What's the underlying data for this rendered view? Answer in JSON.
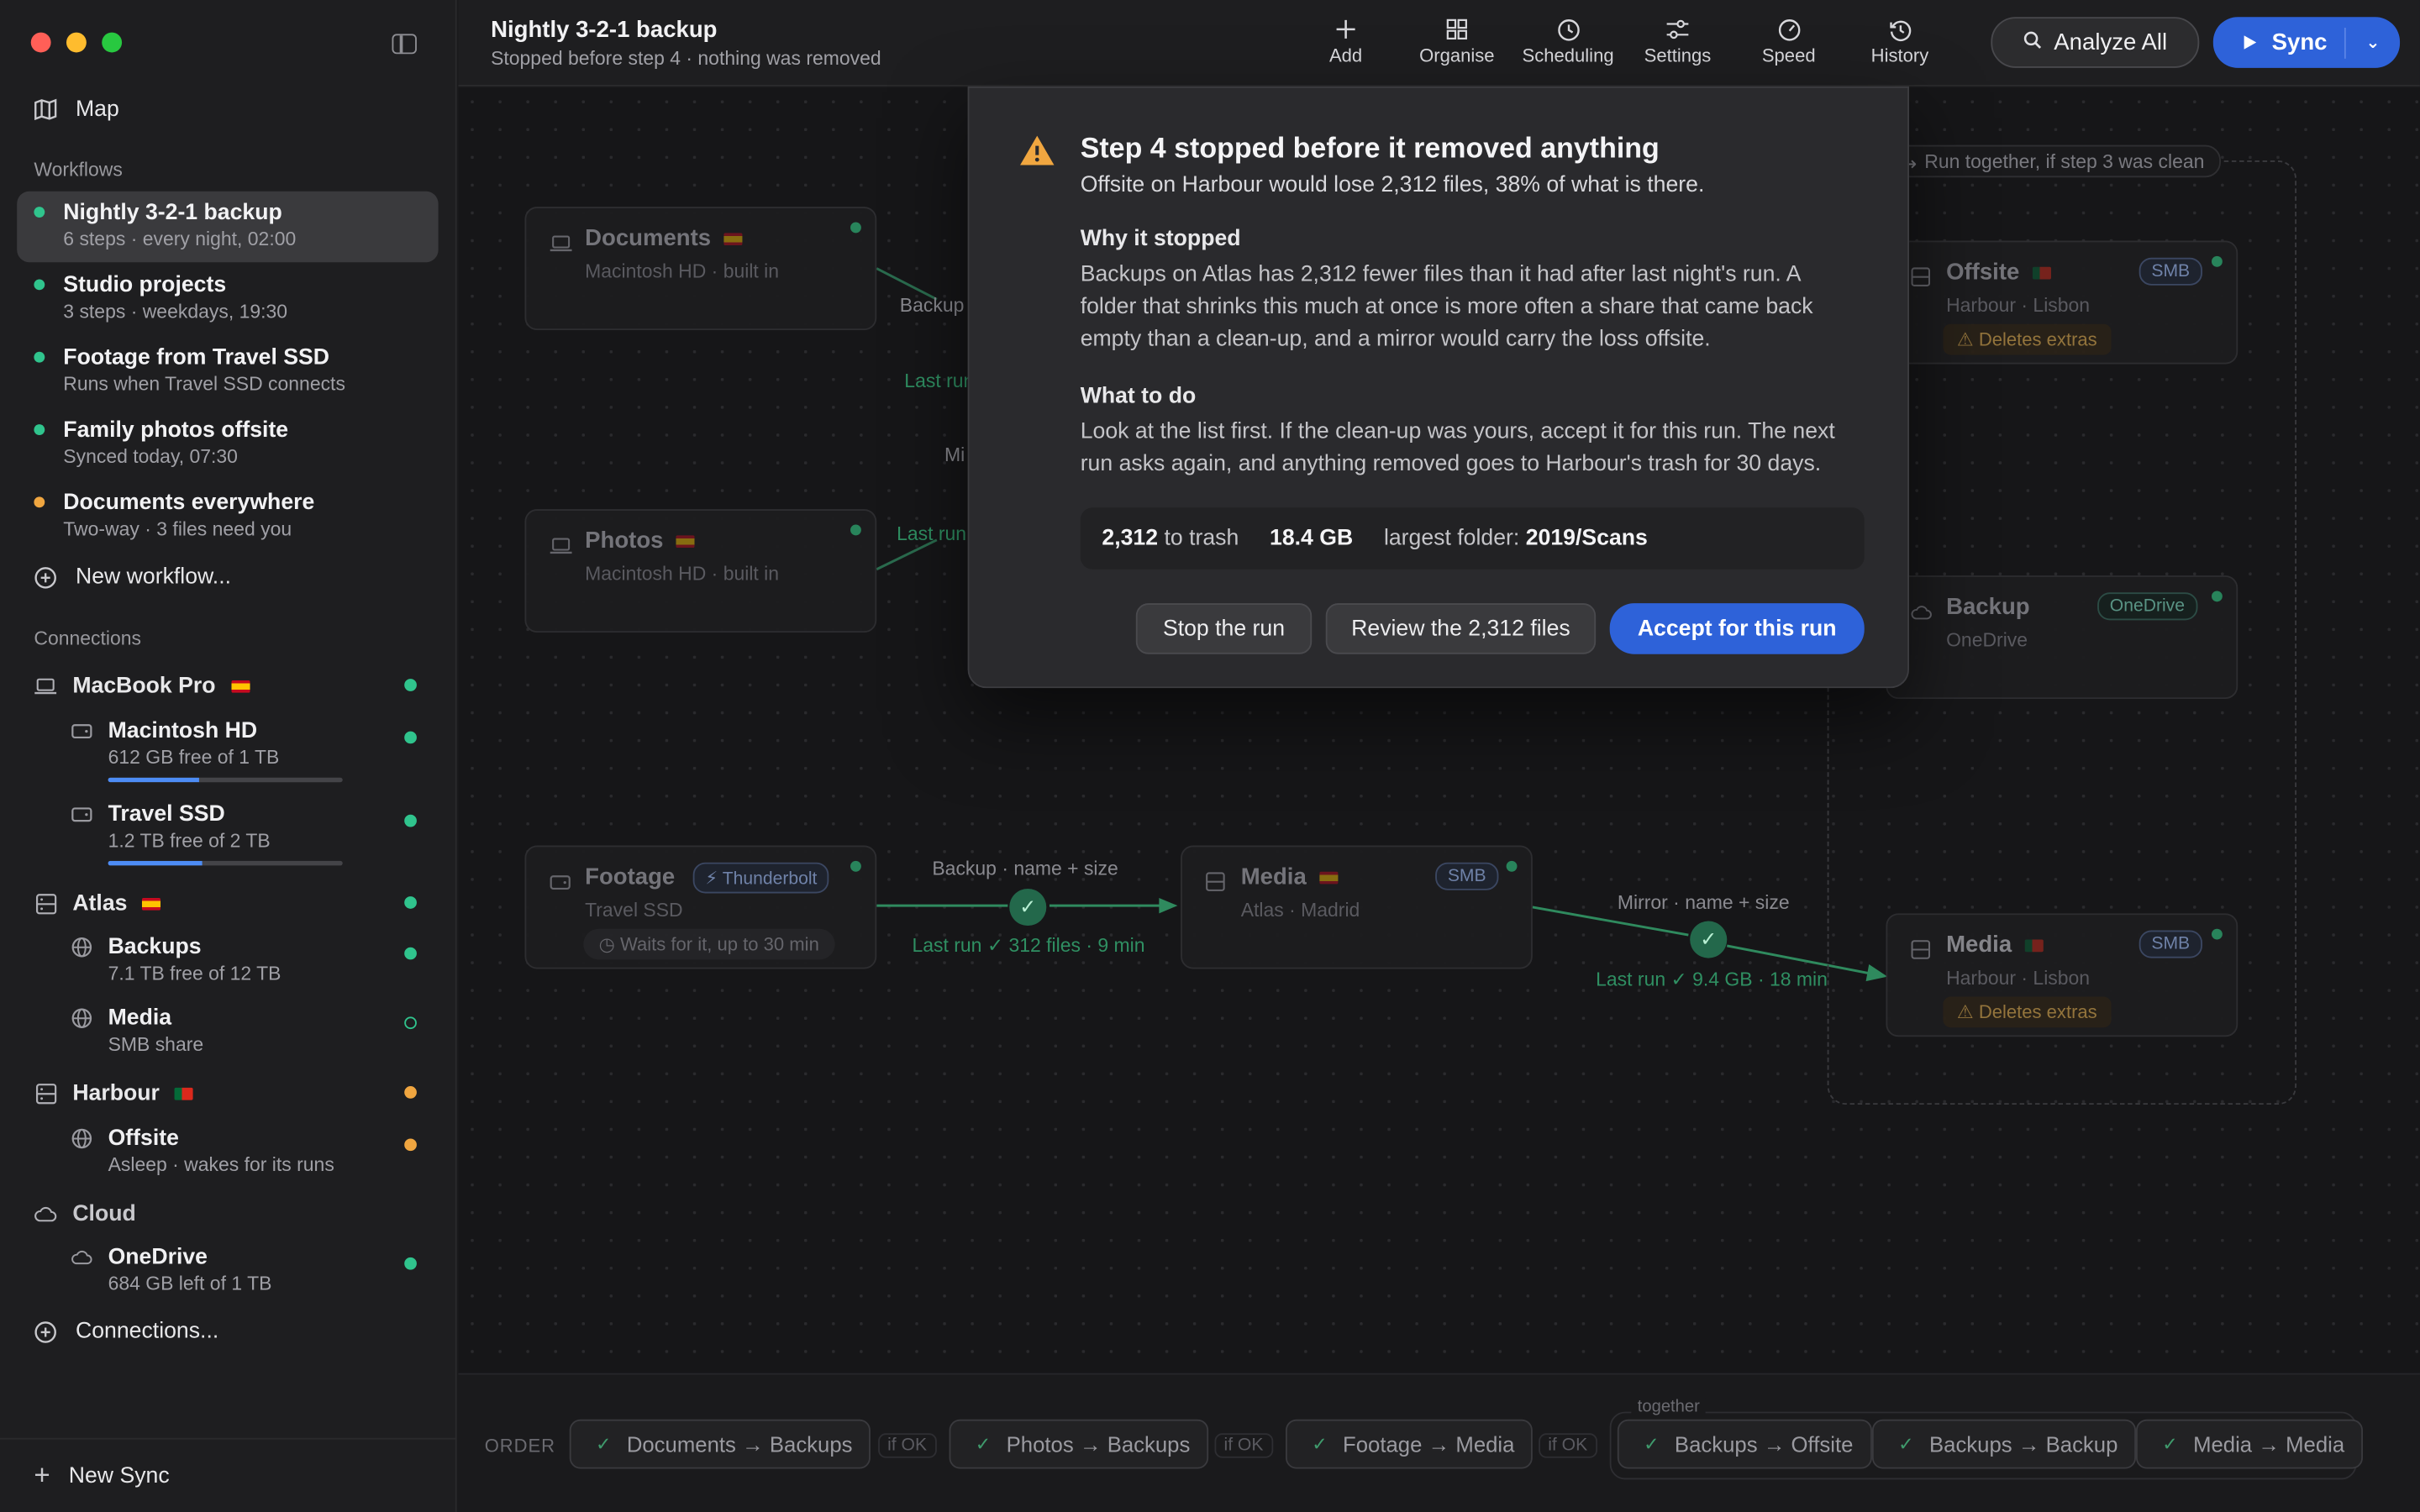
{
  "window": {
    "title": "Nightly 3-2-1 backup",
    "subtitle": "Stopped before step 4 · nothing was removed"
  },
  "sidebar": {
    "map_label": "Map",
    "workflows_title": "Workflows",
    "workflows": [
      {
        "name": "Nightly 3-2-1 backup",
        "meta": "6 steps · every night, 02:00",
        "status": "#30c48d",
        "active": true
      },
      {
        "name": "Studio projects",
        "meta": "3 steps · weekdays, 19:30",
        "status": "#30c48d"
      },
      {
        "name": "Footage from Travel SSD",
        "meta": "Runs when Travel SSD connects",
        "status": "#30c48d"
      },
      {
        "name": "Family photos offsite",
        "meta": "Synced today, 07:30",
        "status": "#30c48d"
      },
      {
        "name": "Documents everywhere",
        "meta": "Two-way · 3 files need you",
        "status": "#f0a640"
      }
    ],
    "new_workflow": "New workflow...",
    "connections_title": "Connections",
    "connections": {
      "macbook": {
        "name": "MacBook Pro",
        "status": "#30c48d"
      },
      "macintosh_hd": {
        "name": "Macintosh HD",
        "meta": "612 GB free of 1 TB",
        "used_fraction": 0.39,
        "status": "#30c48d"
      },
      "travel_ssd": {
        "name": "Travel SSD",
        "meta": "1.2 TB free of 2 TB",
        "used_fraction": 0.4,
        "status": "#30c48d"
      },
      "atlas": {
        "name": "Atlas",
        "status": "#30c48d"
      },
      "backups": {
        "name": "Backups",
        "meta": "7.1 TB free of 12 TB",
        "status": "#30c48d"
      },
      "media": {
        "name": "Media",
        "meta": "SMB share",
        "status": "#30c48d"
      },
      "harbour": {
        "name": "Harbour",
        "status": "#f0a640"
      },
      "offsite": {
        "name": "Offsite",
        "meta": "Asleep · wakes for its runs",
        "status": "#f0a640"
      },
      "cloud": {
        "name": "Cloud"
      },
      "onedrive": {
        "name": "OneDrive",
        "meta": "684 GB left of 1 TB",
        "status": "#30c48d"
      }
    },
    "connections_link": "Connections...",
    "new_sync": "New Sync"
  },
  "toolbar": {
    "buttons": [
      {
        "label": "Add",
        "icon": "plus-icon"
      },
      {
        "label": "Organise",
        "icon": "grid-icon"
      },
      {
        "label": "Scheduling",
        "icon": "clock-icon"
      },
      {
        "label": "Settings",
        "icon": "sliders-icon"
      },
      {
        "label": "Speed",
        "icon": "gauge-icon"
      },
      {
        "label": "History",
        "icon": "history-icon"
      }
    ],
    "analyze": "Analyze All",
    "sync": "Sync"
  },
  "canvas": {
    "nodes": {
      "documents": {
        "title": "Documents",
        "sub": "Macintosh HD · built in"
      },
      "photos": {
        "title": "Photos",
        "sub": "Macintosh HD · built in"
      },
      "footage": {
        "title": "Footage",
        "sub": "Travel SSD",
        "badge": "Thunderbolt",
        "wait": "Waits for it, up to 30 min"
      },
      "media_atlas": {
        "title": "Media",
        "sub": "Atlas · Madrid",
        "badge": "SMB"
      },
      "offsite": {
        "title": "Offsite",
        "sub": "Harbour · Lisbon",
        "badge": "SMB",
        "warn": "Deletes extras"
      },
      "backup_od": {
        "title": "Backup",
        "sub": "OneDrive",
        "badge": "OneDrive"
      },
      "media_harbour": {
        "title": "Media",
        "sub": "Harbour · Lisbon",
        "badge": "SMB",
        "warn": "Deletes extras"
      }
    },
    "edges": {
      "doc_label": "Backup",
      "doc_meta": "Last run",
      "photos_mi": "Mi",
      "photos_meta": "Last run",
      "footage_label": "Backup · name + size",
      "footage_meta": "Last run ✓ 312 files · 9 min",
      "media_label": "Mirror · name + size",
      "media_meta": "Last run ✓ 9.4 GB · 18 min"
    },
    "group_label": "Run together, if step 3 was clean"
  },
  "dialog": {
    "title": "Step 4 stopped before it removed anything",
    "subtitle": "Offsite on Harbour would lose 2,312 files, 38% of what is there.",
    "why_title": "Why it stopped",
    "why_body": "Backups on Atlas has 2,312 fewer files than it had after last night's run. A folder that shrinks this much at once is more often a share that came back empty than a clean-up, and a mirror would carry the loss offsite.",
    "what_title": "What to do",
    "what_body": "Look at the list first. If the clean-up was yours, accept it for this run. The next run asks again, and anything removed goes to Harbour's trash for 30 days.",
    "stats": {
      "count": "2,312",
      "count_label": "to trash",
      "size": "18.4 GB",
      "folder_label": "largest folder:",
      "folder": "2019/Scans"
    },
    "buttons": {
      "stop": "Stop the run",
      "review": "Review the 2,312 files",
      "accept": "Accept for this run"
    }
  },
  "order": {
    "label": "ORDER",
    "together": "together",
    "if_ok": "if OK",
    "steps": [
      "Documents → Backups",
      "Photos → Backups",
      "Footage → Media",
      "Backups → Offsite",
      "Backups → Backup",
      "Media → Media"
    ]
  }
}
